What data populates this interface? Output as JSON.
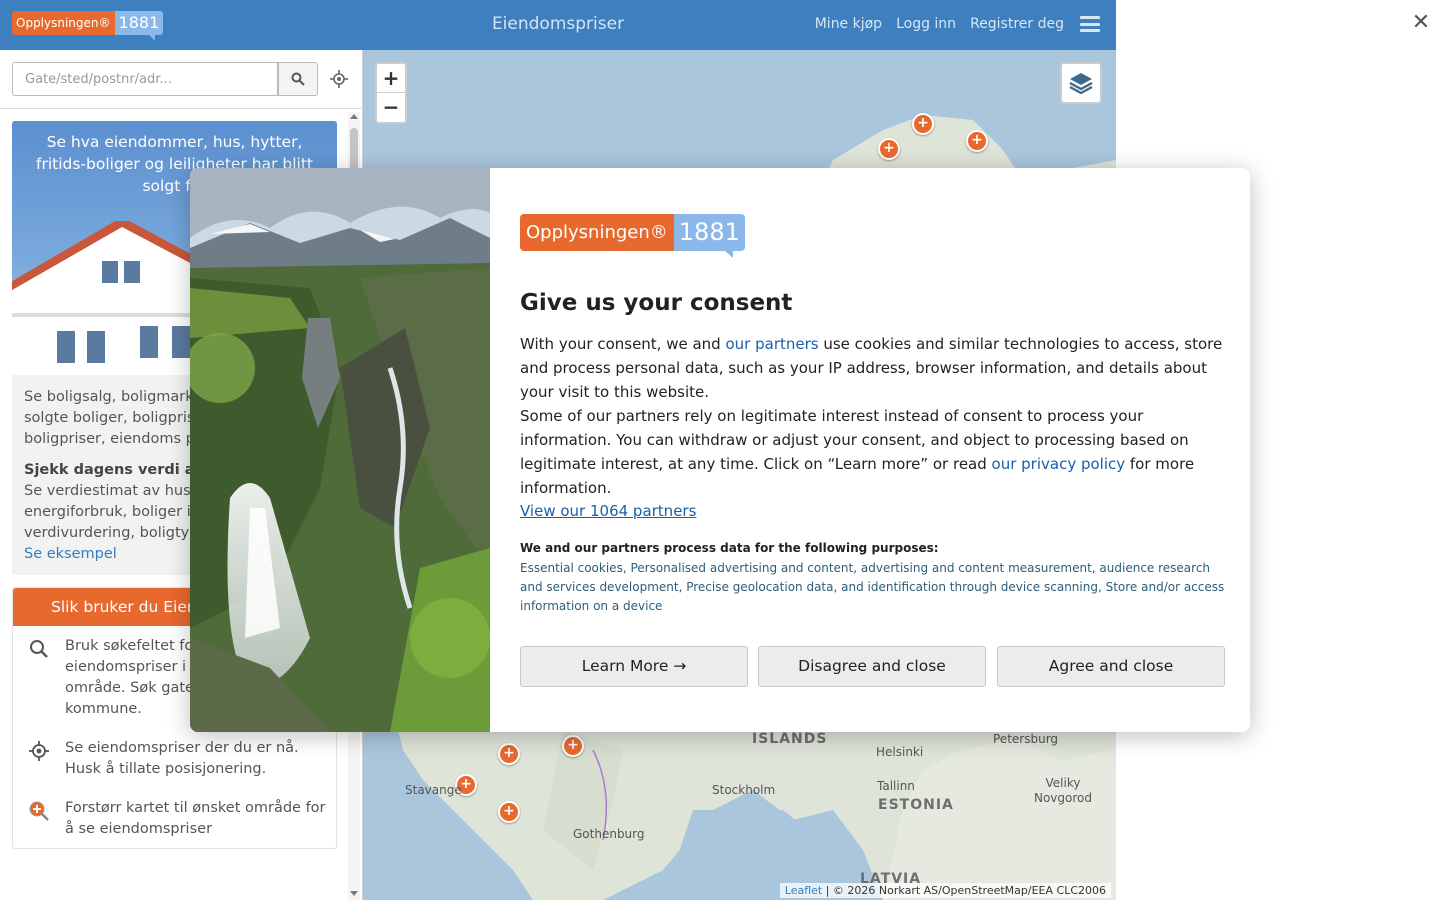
{
  "header": {
    "logo_brand": "Opplysningen®",
    "logo_number": "1881",
    "title": "Eiendomspriser",
    "nav": [
      "Mine kjøp",
      "Logg inn",
      "Registrer deg"
    ],
    "menu_icon": "hamburger-icon"
  },
  "sidebar": {
    "search_placeholder": "Gate/sted/postnr/adr...",
    "search_icon": "search-icon",
    "locate_icon": "crosshair-icon",
    "promo": {
      "headline": "Se hva eiendommer, hus, hytter, fritids-boliger og leiligheter har blitt solgt for",
      "paragraph": "Se boligsalg, boligmarked, boligpriser, solgte boliger, boligprisstatistikk, boligpriser, eiendoms priser i Oslo o",
      "bold_heading": "Sjekk dagens verdi av e",
      "paragraph2": "Se verdiestimat av hus, estimert energiforbruk, boliger i området; prises verdivurdering, boligtyp",
      "example_link": "Se eksempel"
    },
    "howto": {
      "heading": "Slik bruker du Eien",
      "items": [
        {
          "icon": "search-icon",
          "text": "Bruk søkefeltet for å se eiendomspriser i et bestemt område. Søk gate, sted eller kommune."
        },
        {
          "icon": "crosshair-icon",
          "text": "Se eiendomspriser der du er nå. Husk å tillate posisjonering."
        },
        {
          "icon": "zoom-in-icon",
          "text": "Forstørr kartet til ønsket område for å se eiendomspriser"
        }
      ]
    }
  },
  "map": {
    "zoom_in": "+",
    "zoom_out": "−",
    "layers_icon": "layers-icon",
    "labels": [
      "ISLANDS",
      "Helsinki",
      "Petersburg",
      "Tallinn",
      "Stockholm",
      "ESTONIA",
      "Veliky Novgorod",
      "Stavange",
      "Gothenburg",
      "LATVIA"
    ],
    "attribution_link": "Leaflet",
    "attribution_text": " | © 2026 Norkart AS/OpenStreetMap/EEA CLC2006"
  },
  "dialog": {
    "logo_brand": "Opplysningen®",
    "logo_number": "1881",
    "title": "Give us your consent",
    "p1_before": "With your consent, we and ",
    "p1_link": "our partners",
    "p1_after": " use cookies and similar technologies to access, store and process personal data, such as your IP address, browser information, and details about your visit to this website.",
    "p2_before": "Some of our partners rely on legitimate interest instead of consent to process your information. You can withdraw or adjust your consent, and object to processing based on legitimate interest, at any time. Click on “Learn more” or read ",
    "p2_link": "our privacy policy",
    "p2_after": " for more information.",
    "view_partners": "View our 1064 partners",
    "purposes_title": "We and our partners process data for the following purposes:",
    "purposes": "Essential cookies, Personalised advertising and content, advertising and content measurement, audience research and services development, Precise geolocation data, and identification through device scanning, Store and/or access information on a device",
    "buttons": {
      "learn": "Learn More →",
      "disagree": "Disagree and close",
      "agree": "Agree and close"
    }
  },
  "close_icon": "close-icon",
  "colors": {
    "header_blue": "#3d7fbf",
    "brand_orange": "#e8692e",
    "brand_light_blue": "#8bb8e8",
    "link_blue": "#1a5fa8"
  }
}
